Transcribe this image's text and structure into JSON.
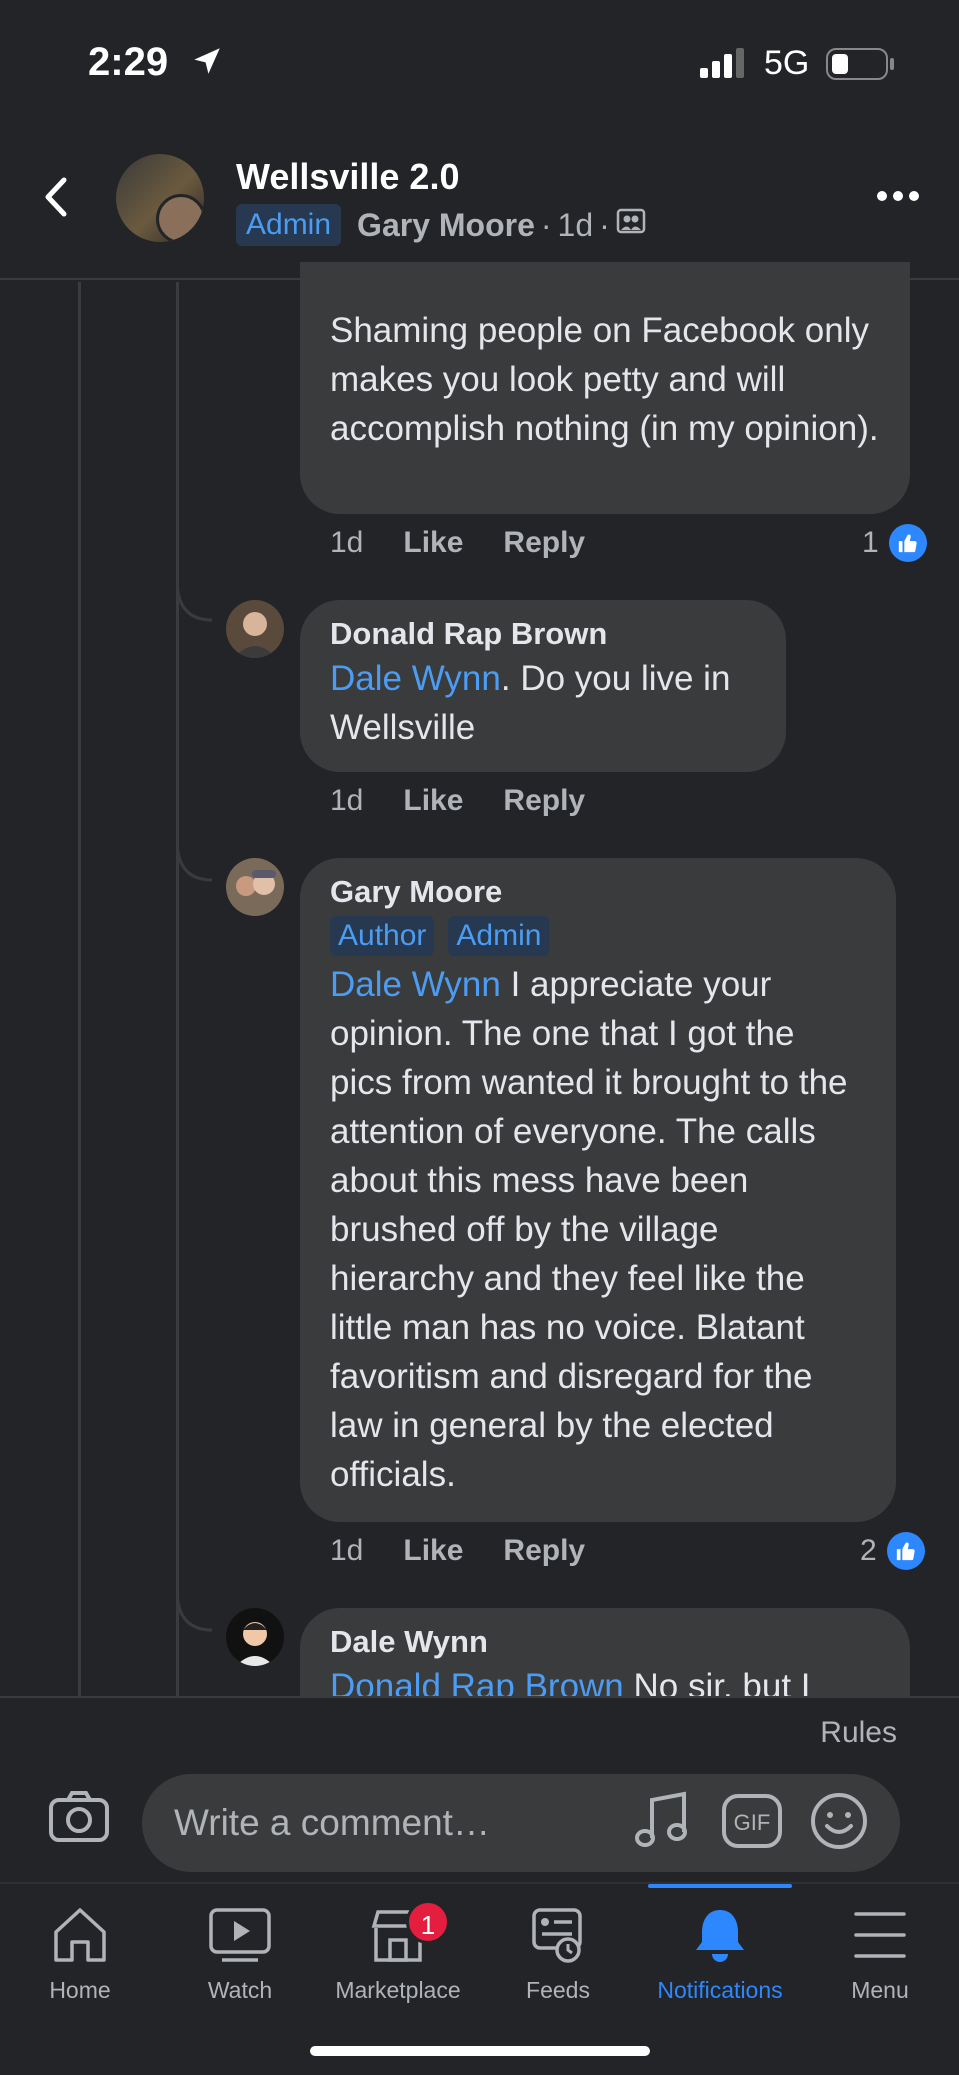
{
  "status_bar": {
    "time": "2:29",
    "network": "5G"
  },
  "header": {
    "group_name": "Wellsville 2.0",
    "role_badge": "Admin",
    "author": "Gary Moore",
    "time": "1d",
    "separator": "·"
  },
  "comments": [
    {
      "text": "Shaming people on Facebook only makes you look petty and will accomplish nothing (in my opinion).",
      "time": "1d",
      "like_label": "Like",
      "reply_label": "Reply",
      "reaction_count": "1"
    },
    {
      "name": "Donald Rap Brown",
      "mention": "Dale Wynn",
      "text": ". Do you live in Wellsville",
      "time": "1d",
      "like_label": "Like",
      "reply_label": "Reply"
    },
    {
      "name": "Gary Moore",
      "badges": [
        "Author",
        "Admin"
      ],
      "mention": "Dale Wynn",
      "text": " I appreciate your opinion. The one that I got the pics from wanted it brought to the attention of everyone. The calls about this mess have been brushed off by the village hierarchy and they feel like the little man has no voice. Blatant favoritism and disregard for the law in general by the elected officials.",
      "time": "1d",
      "like_label": "Like",
      "reply_label": "Reply",
      "reaction_count": "2"
    },
    {
      "name": "Dale Wynn",
      "mention": "Donald Rap Brown",
      "text": " No sir, but I"
    }
  ],
  "composer": {
    "rules_label": "Rules",
    "placeholder": "Write a comment…"
  },
  "tabs": [
    {
      "label": "Home"
    },
    {
      "label": "Watch"
    },
    {
      "label": "Marketplace",
      "badge": "1"
    },
    {
      "label": "Feeds"
    },
    {
      "label": "Notifications"
    },
    {
      "label": "Menu"
    }
  ],
  "colors": {
    "background": "#232427",
    "bubble": "#3a3b3c",
    "accent": "#2d88ff",
    "mention": "#4b9cf2"
  }
}
